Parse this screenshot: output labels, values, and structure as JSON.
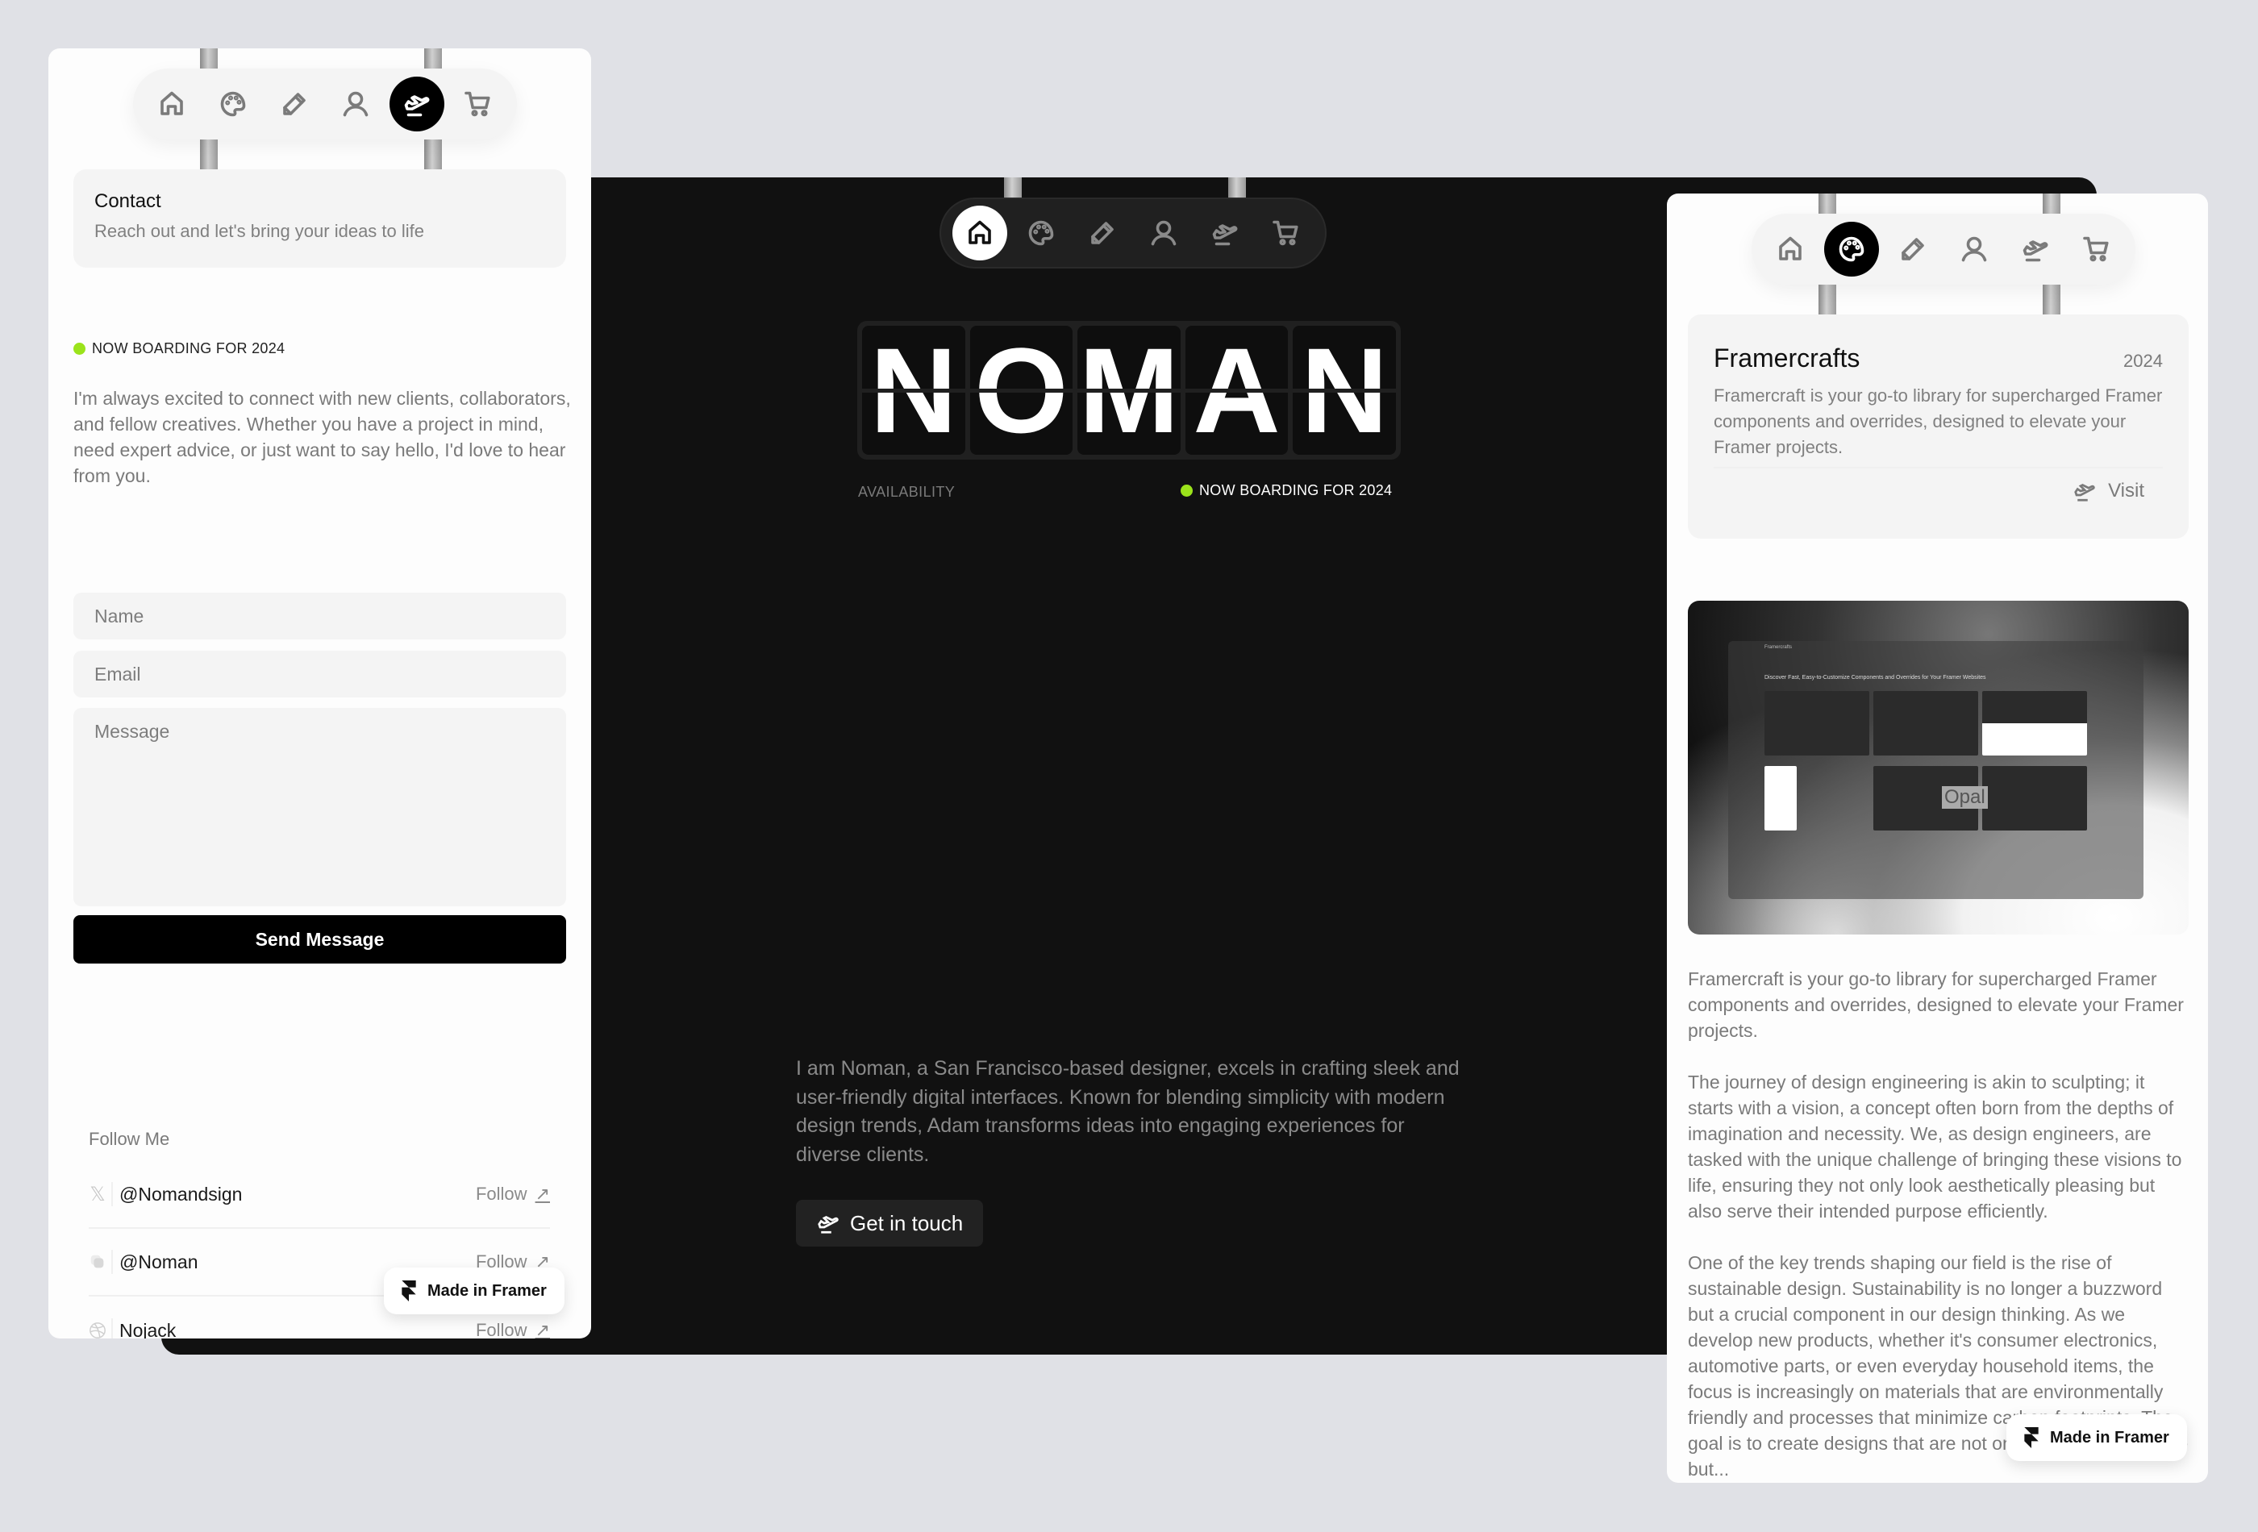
{
  "nav": {
    "items": [
      {
        "name": "home",
        "icon": "home-icon"
      },
      {
        "name": "work",
        "icon": "palette-icon"
      },
      {
        "name": "blog",
        "icon": "pencil-icon"
      },
      {
        "name": "about",
        "icon": "user-icon"
      },
      {
        "name": "contact",
        "icon": "plane-landing-icon"
      },
      {
        "name": "shop",
        "icon": "cart-icon"
      }
    ]
  },
  "left_card": {
    "active_nav": "contact",
    "contact_box": {
      "title": "Contact",
      "subtitle": "Reach out and let's bring your ideas to life"
    },
    "status": "NOW BOARDING FOR 2024",
    "intro": "I'm always excited to connect with new clients, collaborators, and fellow creatives. Whether you have a project in mind, need expert advice, or just want to say hello, I'd love to hear from you.",
    "form": {
      "name_placeholder": "Name",
      "email_placeholder": "Email",
      "message_placeholder": "Message",
      "submit_label": "Send Message"
    },
    "follow": {
      "heading": "Follow Me",
      "items": [
        {
          "icon": "x-twitter-icon",
          "handle": "@Nomandsign",
          "action": "Follow"
        },
        {
          "icon": "threads-icon",
          "handle": "@Noman",
          "action": "Follow"
        },
        {
          "icon": "dribbble-icon",
          "handle": "Nojack",
          "action": "Follow"
        }
      ]
    },
    "badge": "Made in Framer"
  },
  "center_panel": {
    "active_nav": "home",
    "board_letters": [
      "N",
      "O",
      "M",
      "A",
      "N"
    ],
    "availability_label": "AVAILABILITY",
    "status": "NOW BOARDING FOR 2024",
    "bio": "I am Noman, a San Francisco-based designer, excels in crafting sleek and user-friendly digital interfaces. Known for blending simplicity with modern design trends, Adam transforms ideas into engaging experiences for diverse clients.",
    "cta_label": "Get in touch"
  },
  "right_card": {
    "active_nav": "work",
    "project": {
      "title": "Framercrafts",
      "year": "2024",
      "description": "Framercraft is your go-to library for supercharged Framer components and overrides, designed to elevate your Framer projects.",
      "visit_label": "Visit"
    },
    "preview": {
      "site_name": "Framercrafts",
      "headline": "Discover Fast, Easy-to-Customize Components and Overrides for Your Framer Websites",
      "opal_label": "Opal"
    },
    "paragraphs": [
      "Framercraft is your go-to library for supercharged Framer components and overrides, designed to elevate your Framer projects.",
      "The journey of design engineering is akin to sculpting; it starts with a vision, a concept often born from the depths of imagination and necessity. We, as design engineers, are tasked with the unique challenge of bringing these visions to life, ensuring they not only look aesthetically pleasing but also serve their intended purpose efficiently.",
      "One of the key trends shaping our field is the rise of sustainable design. Sustainability is no longer a buzzword but a crucial component in our design thinking. As we develop new products, whether it's consumer electronics, automotive parts, or even everyday household items, the focus is increasingly on materials that are environmentally friendly and processes that minimize carbon footprints. The goal is to create designs that are not only ethical and durable but..."
    ],
    "badge": "Made in Framer"
  },
  "colors": {
    "page_bg": "#e0e1e6",
    "dark_panel": "#111111",
    "status_dot": "#9be31b",
    "accent_black": "#000000"
  }
}
